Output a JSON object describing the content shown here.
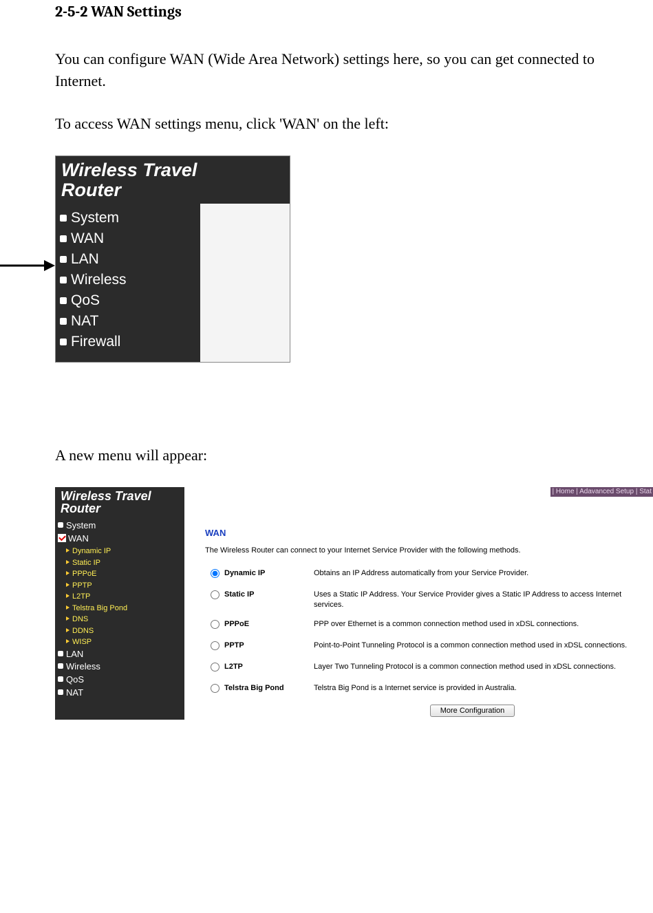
{
  "heading": "2-5-2 WAN Settings",
  "para1": "You can configure WAN (Wide Area Network) settings here, so you can get connected to Internet.",
  "para2": "To access WAN settings menu, click 'WAN' on the left:",
  "para3": "A new menu will appear:",
  "shot1": {
    "title_line1": "Wireless Travel",
    "title_line2": "Router",
    "nav": [
      "System",
      "WAN",
      "LAN",
      "Wireless",
      "QoS",
      "NAT",
      "Firewall"
    ]
  },
  "shot2": {
    "topbar": "| Home | Adavanced Setup | Stat",
    "title_line1": "Wireless Travel",
    "title_line2": "Router",
    "nav_top": "System",
    "nav_selected": "WAN",
    "nav_sub": [
      "Dynamic IP",
      "Static IP",
      "PPPoE",
      "PPTP",
      "L2TP",
      "Telstra Big Pond",
      "DNS",
      "DDNS",
      "WISP"
    ],
    "nav_rest": [
      "LAN",
      "Wireless",
      "QoS",
      "NAT"
    ],
    "content": {
      "title": "WAN",
      "intro": "The Wireless Router can connect to your Internet Service Provider with the following methods.",
      "options": [
        {
          "value": "dynamic",
          "label": "Dynamic IP",
          "desc": "Obtains an IP Address automatically from your Service Provider.",
          "checked": true
        },
        {
          "value": "static",
          "label": "Static IP",
          "desc": "Uses a Static IP Address. Your Service Provider gives a Static IP Address to access Internet services.",
          "checked": false
        },
        {
          "value": "pppoe",
          "label": "PPPoE",
          "desc": "PPP over Ethernet is a common connection method used in xDSL connections.",
          "checked": false
        },
        {
          "value": "pptp",
          "label": "PPTP",
          "desc": "Point-to-Point Tunneling Protocol is a common connection method used in xDSL connections.",
          "checked": false
        },
        {
          "value": "l2tp",
          "label": "L2TP",
          "desc": "Layer Two Tunneling Protocol is a common connection method used in xDSL connections.",
          "checked": false
        },
        {
          "value": "telstra",
          "label": "Telstra Big Pond",
          "desc": "Telstra Big Pond is a Internet service is provided in Australia.",
          "checked": false
        }
      ],
      "more_button": "More Configuration"
    }
  }
}
